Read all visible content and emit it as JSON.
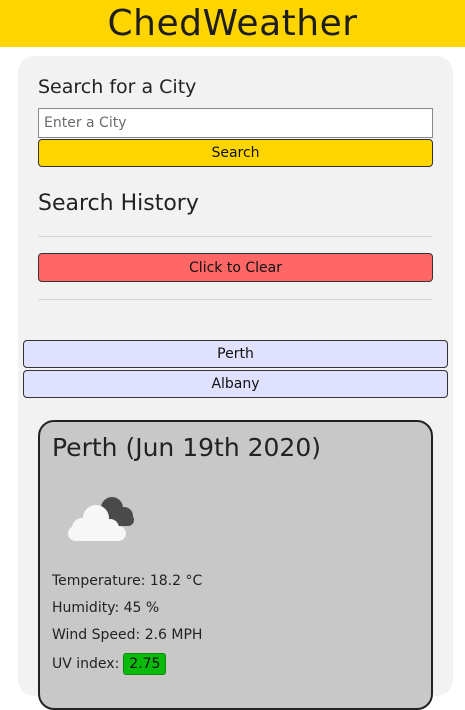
{
  "header": {
    "title": "ChedWeather"
  },
  "search": {
    "title": "Search for a City",
    "placeholder": "Enter a City",
    "button_label": "Search"
  },
  "history": {
    "title": "Search History",
    "clear_label": "Click to Clear",
    "items": [
      {
        "label": "Perth"
      },
      {
        "label": "Albany"
      }
    ]
  },
  "weather": {
    "title": "Perth (Jun 19th 2020)",
    "icon": "cloud-icon",
    "temperature": "Temperature: 18.2 °C",
    "humidity": "Humidity: 45 %",
    "wind": "Wind Speed: 2.6 MPH",
    "uv_label": "UV index:",
    "uv_value": "2.75"
  },
  "colors": {
    "header_bg": "#ffd500",
    "search_button": "#ffd500",
    "clear_button": "#ff6666",
    "history_item": "#e0e0ff",
    "card_bg": "#c8c8c8",
    "uv_badge": "#0aba0a"
  }
}
